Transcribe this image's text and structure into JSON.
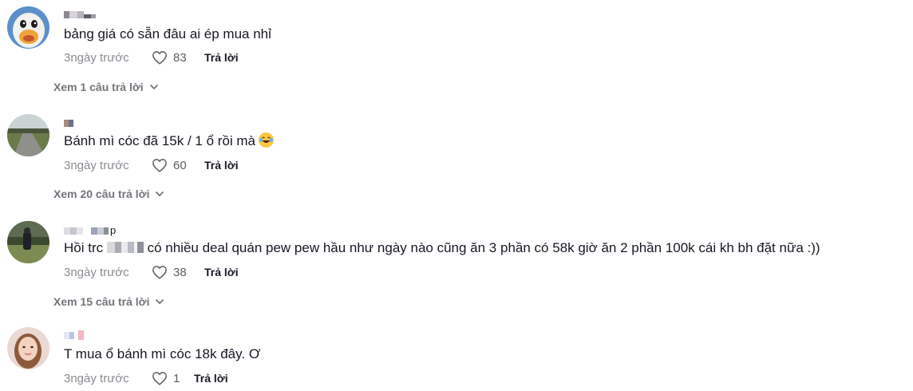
{
  "comments": [
    {
      "text": "bảng giá có sẵn đâu ai ép mua nhỉ",
      "time": "3ngày trước",
      "likes": "83",
      "reply": "Trả lời",
      "view_replies": "Xem 1 câu trả lời",
      "avatar": "duck-avatar"
    },
    {
      "text": "Bánh mì cóc đã 15k / 1 ổ rồi mà",
      "emoji": "laughing-tears-emoji",
      "time": "3ngày trước",
      "likes": "60",
      "reply": "Trả lời",
      "view_replies": "Xem 20 câu trả lời",
      "avatar": "road-avatar"
    },
    {
      "username_visible": "p",
      "text_part1": "Hồi trc",
      "text_part2": "có nhiều deal quán pew pew hầu như ngày nào cũng ăn 3 phần có 58k giờ ăn 2 phần 100k cái kh bh đặt nữa :))",
      "time": "3ngày trước",
      "likes": "38",
      "reply": "Trả lời",
      "view_replies": "Xem 15 câu trả lời",
      "avatar": "field-person-avatar"
    },
    {
      "text": "T mua ổ bánh mì cóc 18k đây. Ơ",
      "time": "3ngày trước",
      "likes": "1",
      "reply": "Trả lời",
      "avatar": "woman-avatar"
    }
  ],
  "colors": {
    "primary_text": "#161823",
    "secondary_text": "#8a8b91",
    "view_replies": "#73747b"
  }
}
